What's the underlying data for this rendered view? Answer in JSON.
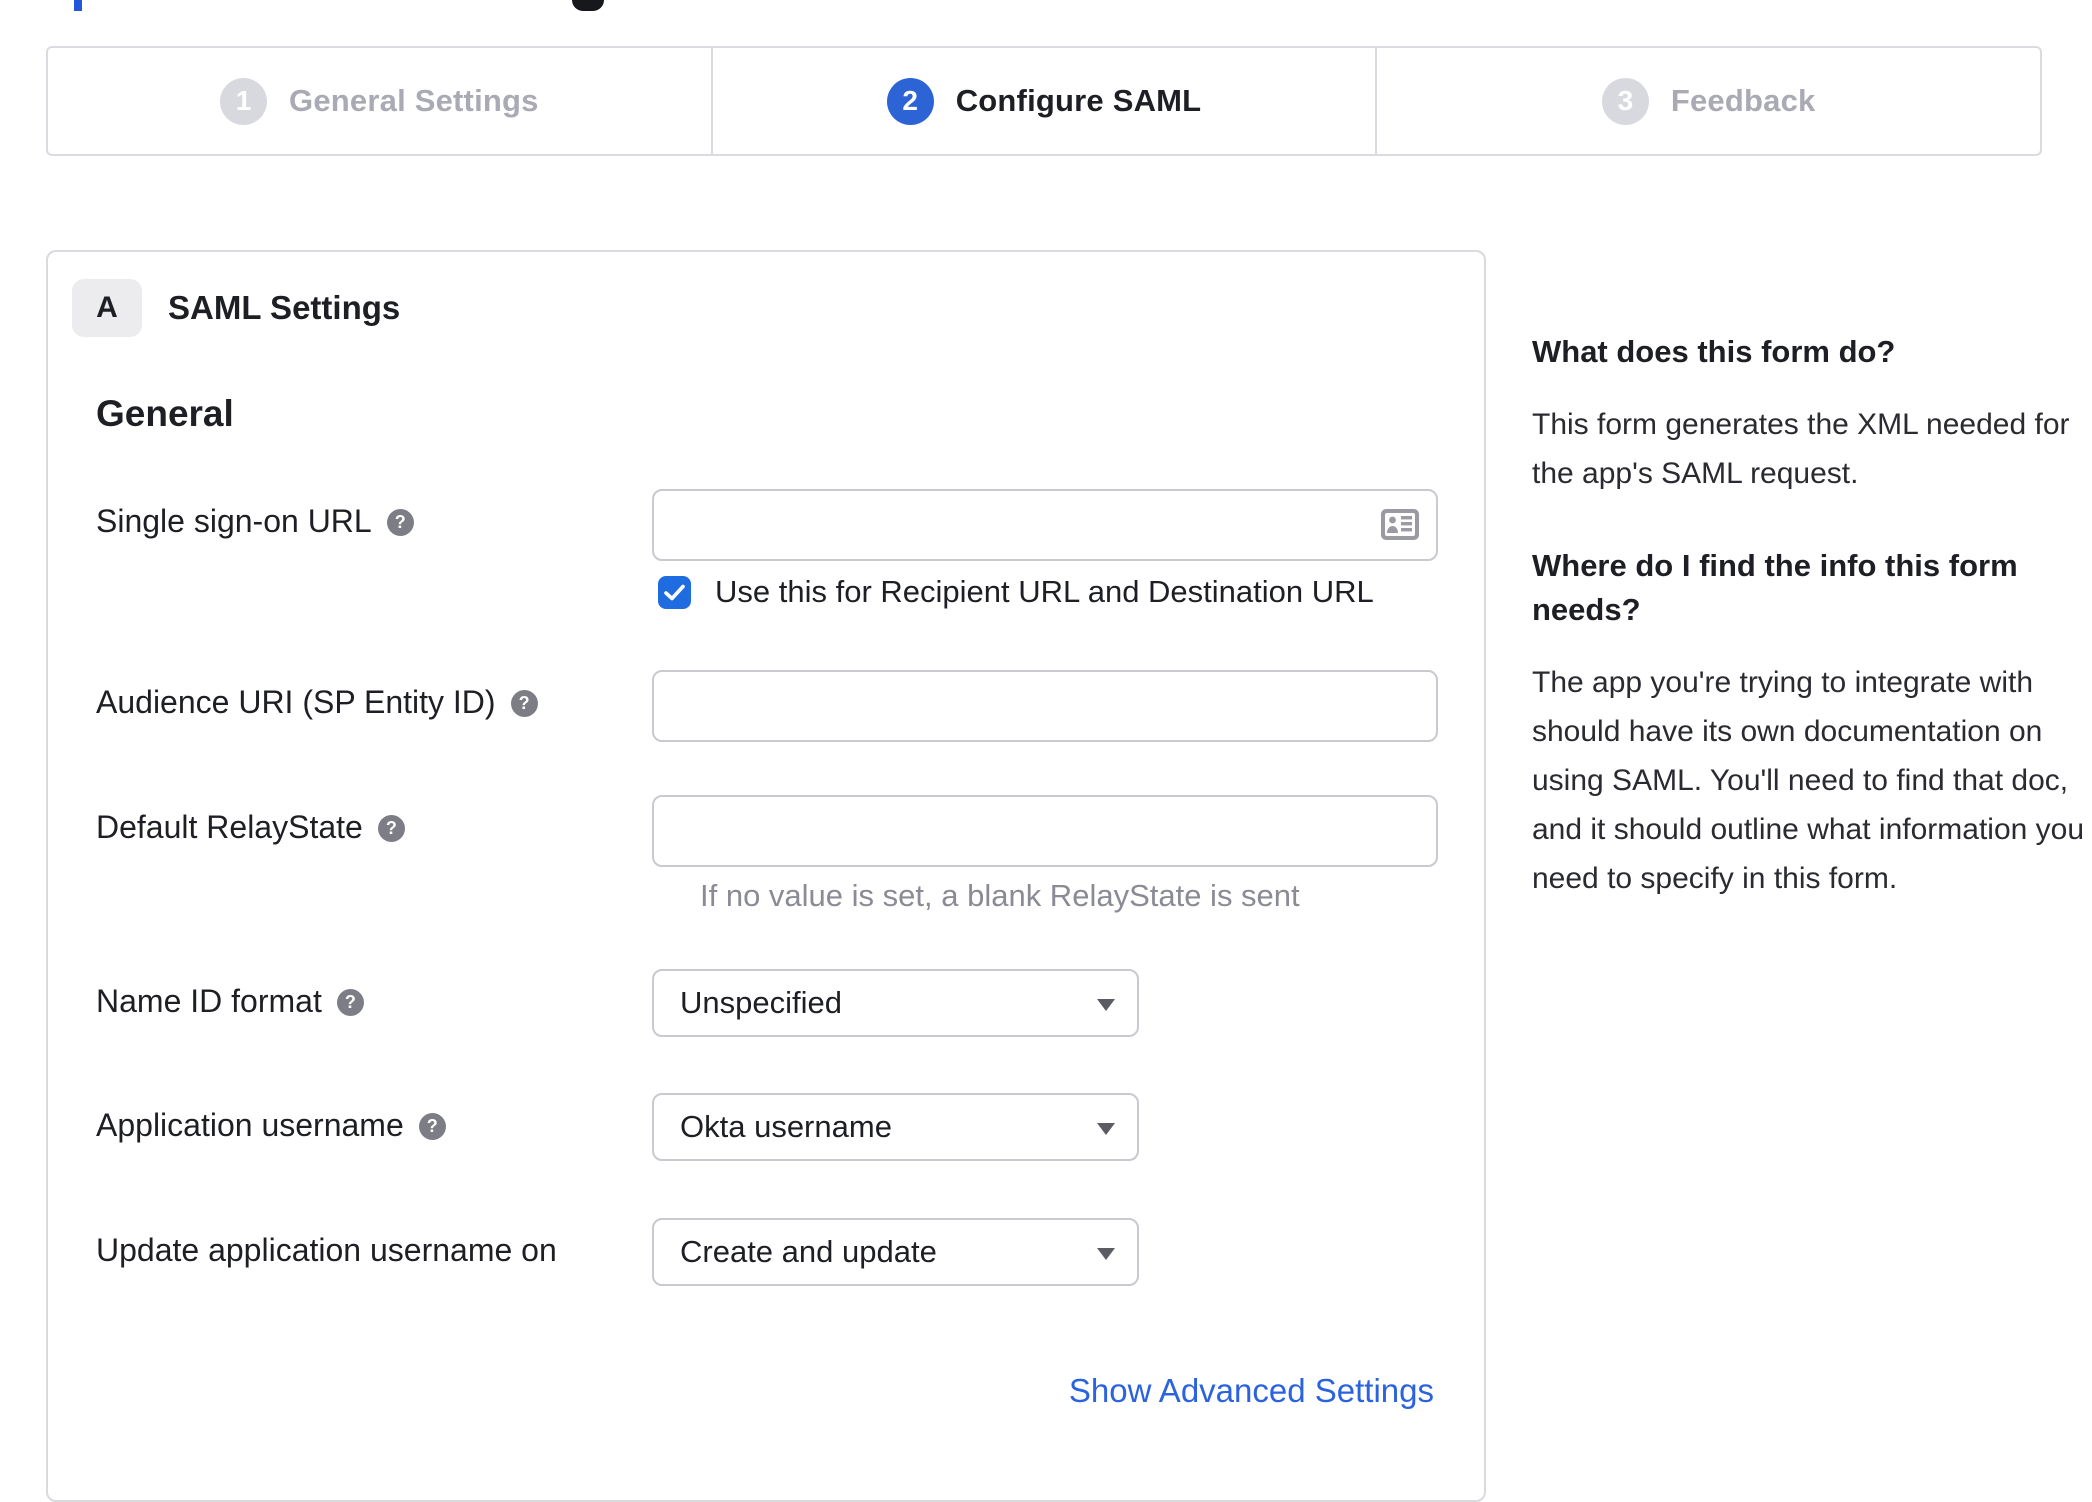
{
  "wizard": {
    "steps": [
      {
        "number": "1",
        "label": "General Settings",
        "state": "inactive"
      },
      {
        "number": "2",
        "label": "Configure SAML",
        "state": "active"
      },
      {
        "number": "3",
        "label": "Feedback",
        "state": "inactive"
      }
    ]
  },
  "panel": {
    "badge": "A",
    "title": "SAML Settings",
    "section_heading": "General"
  },
  "form": {
    "sso": {
      "label": "Single sign-on URL",
      "value": "",
      "checkbox_label": "Use this for Recipient URL and Destination URL",
      "checked": true
    },
    "audience": {
      "label": "Audience URI (SP Entity ID)",
      "value": ""
    },
    "relay": {
      "label": "Default RelayState",
      "value": "",
      "hint": "If no value is set, a blank RelayState is sent"
    },
    "name_id": {
      "label": "Name ID format",
      "selected": "Unspecified"
    },
    "app_username": {
      "label": "Application username",
      "selected": "Okta username"
    },
    "update_username": {
      "label": "Update application username on",
      "selected": "Create and update"
    },
    "advanced_link": "Show Advanced Settings"
  },
  "sidebar": {
    "q1": "What does this form do?",
    "a1": "This form generates the XML needed for the app's SAML request.",
    "q2": "Where do I find the info this form needs?",
    "a2": "The app you're trying to integrate with should have its own documentation on using SAML. You'll need to find that doc, and it should outline what information you need to specify in this form."
  },
  "colors": {
    "active_step_blue": "#2c63d5",
    "checkbox_blue": "#1f6be0",
    "link_blue": "#2b63df",
    "inactive_gray": "#a9aab3",
    "border_gray": "#d9d9de",
    "hint_gray": "#8a8b94"
  }
}
